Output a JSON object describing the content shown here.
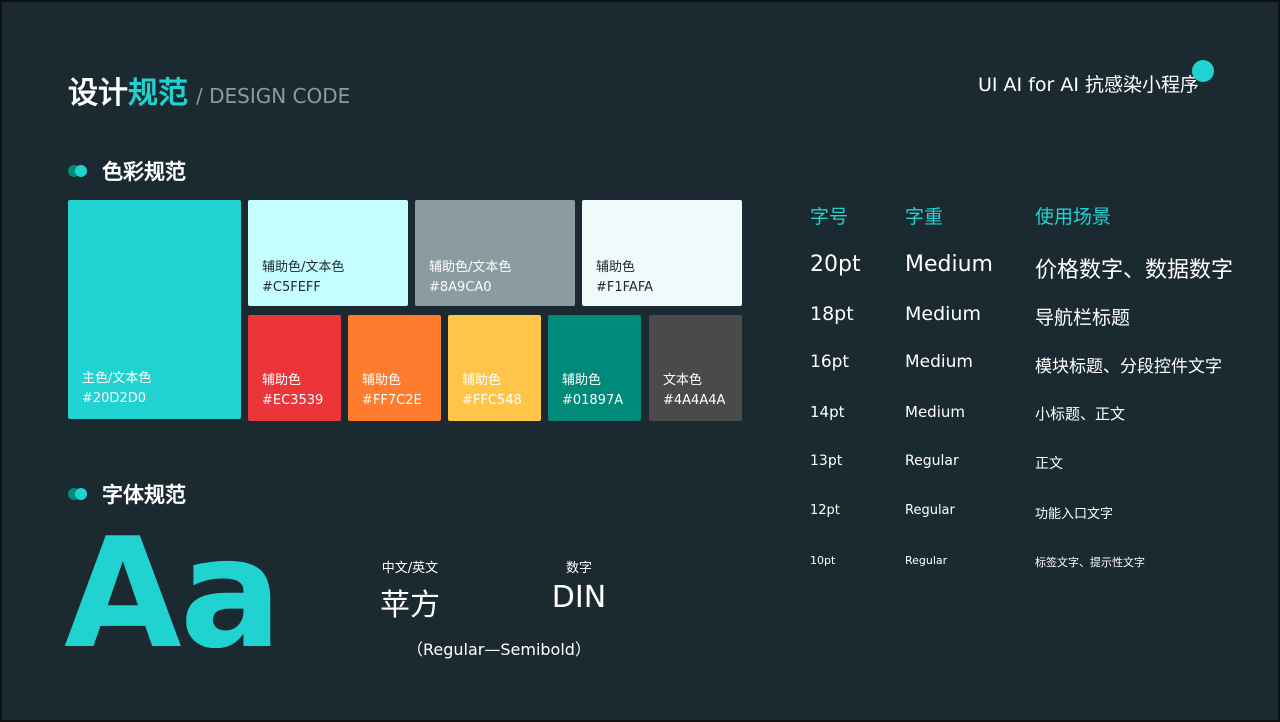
{
  "header": {
    "title_part1": "设计",
    "title_part2": "规范",
    "title_sub": "/ DESIGN CODE",
    "project": "UI  AI for AI 抗感染小程序"
  },
  "sections": {
    "color": "色彩规范",
    "font": "字体规范"
  },
  "colors": {
    "background": "#1B2A30",
    "accent": "#20D2D0",
    "accent_dark": "#01897A"
  },
  "swatches": [
    {
      "name": "主色/文本色",
      "hex": "#20D2D0",
      "text_color": "#FFFFFF"
    },
    {
      "name": "辅助色/文本色",
      "hex": "#C5FEFF",
      "text_color": "#1B2A30"
    },
    {
      "name": "辅助色/文本色",
      "hex": "#8A9CA0",
      "text_color": "#FFFFFF"
    },
    {
      "name": "辅助色",
      "hex": "#F1FAFA",
      "text_color": "#1B2A30"
    },
    {
      "name": "辅助色",
      "hex": "#EC3539",
      "text_color": "#FFFFFF"
    },
    {
      "name": "辅助色",
      "hex": "#FF7C2E",
      "text_color": "#FFFFFF"
    },
    {
      "name": "辅助色",
      "hex": "#FFC548",
      "text_color": "#FFFFFF"
    },
    {
      "name": "辅助色",
      "hex": "#01897A",
      "text_color": "#FFFFFF"
    },
    {
      "name": "文本色",
      "hex": "#4A4A4A",
      "text_color": "#FFFFFF"
    }
  ],
  "fonts": {
    "preview": "Aa",
    "cn_label": "中文/英文",
    "cn_font": "苹方",
    "num_label": "数字",
    "num_font": "DIN",
    "weights": "（Regular—Semibold）"
  },
  "type_scale": {
    "headers": [
      "字号",
      "字重",
      "使用场景"
    ],
    "rows": [
      {
        "size": "20pt",
        "weight": "Medium",
        "usage": "价格数字、数据数字"
      },
      {
        "size": "18pt",
        "weight": "Medium",
        "usage": "导航栏标题"
      },
      {
        "size": "16pt",
        "weight": "Medium",
        "usage": "模块标题、分段控件文字"
      },
      {
        "size": "14pt",
        "weight": "Medium",
        "usage": "小标题、正文"
      },
      {
        "size": "13pt",
        "weight": "Regular",
        "usage": "正文"
      },
      {
        "size": "12pt",
        "weight": "Regular",
        "usage": "功能入口文字"
      },
      {
        "size": "10pt",
        "weight": "Regular",
        "usage": "标签文字、提示性文字"
      }
    ]
  }
}
